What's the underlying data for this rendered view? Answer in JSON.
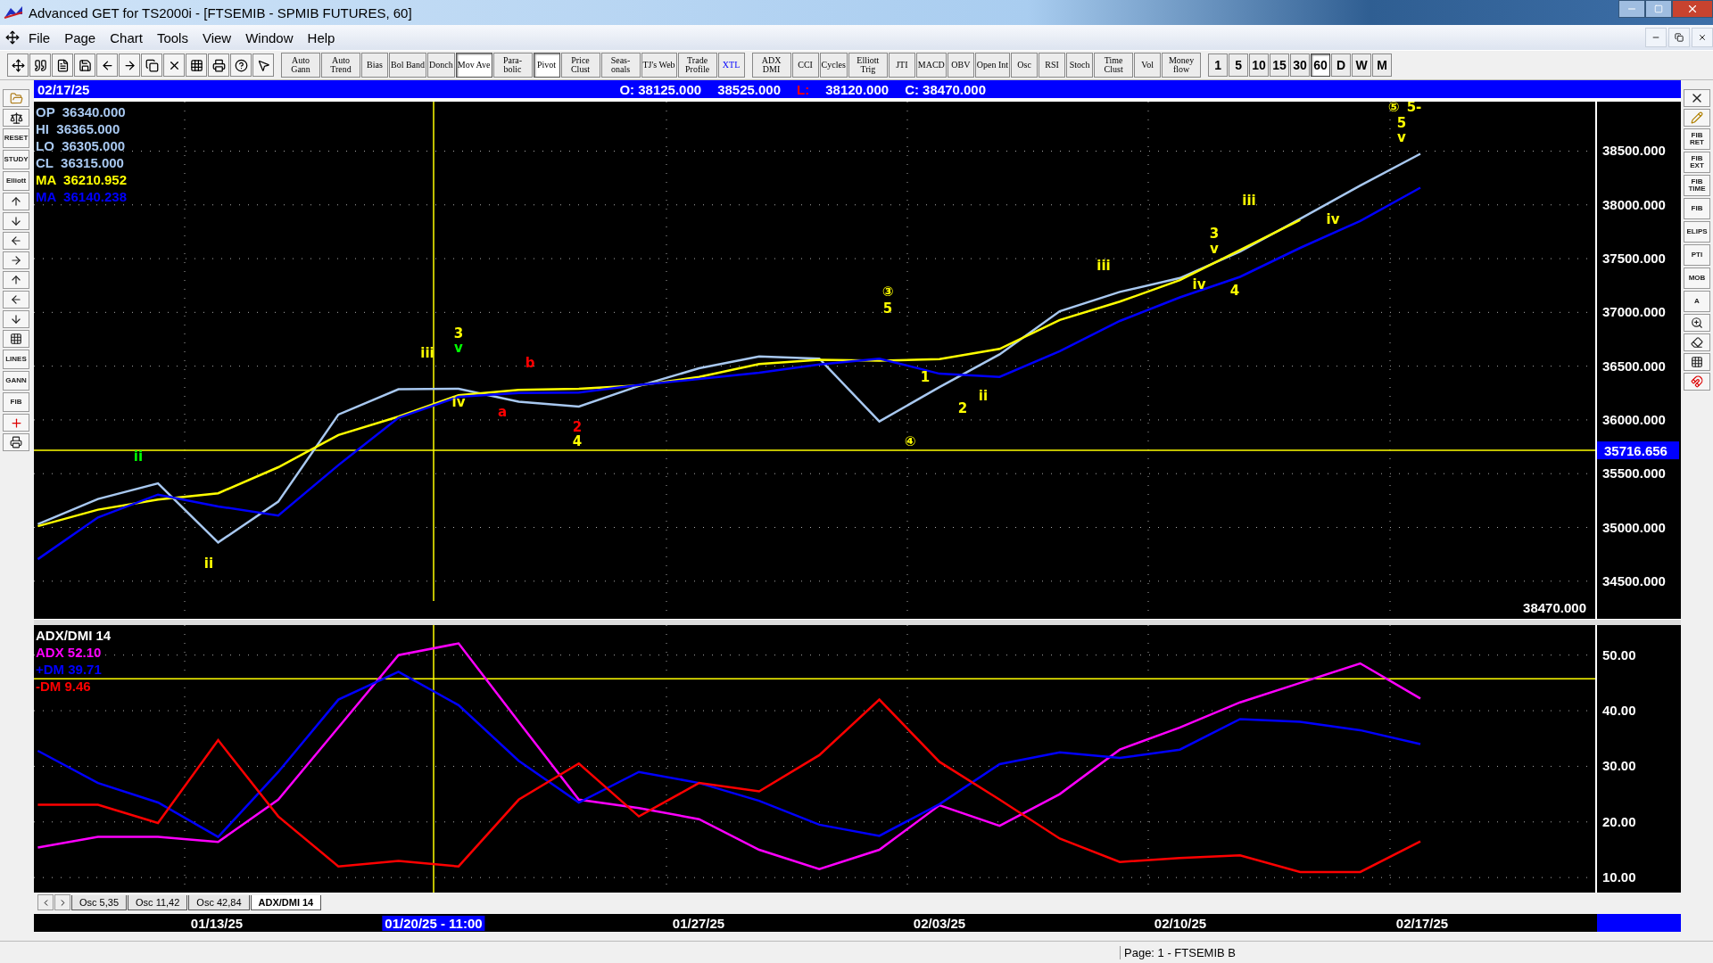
{
  "window": {
    "title": "Advanced GET for TS2000i - [FTSEMIB - SPMIB FUTURES, 60]"
  },
  "menu": [
    "File",
    "Page",
    "Chart",
    "Tools",
    "View",
    "Window",
    "Help"
  ],
  "toolbar": {
    "study_buttons": [
      {
        "label": "Auto Gann",
        "selected": false
      },
      {
        "label": "Auto Trend",
        "selected": false
      },
      {
        "label": "Bias",
        "selected": false
      },
      {
        "label": "Bol Band",
        "selected": false
      },
      {
        "label": "Donch",
        "selected": false
      },
      {
        "label": "Mov Ave",
        "selected": true
      },
      {
        "label": "Para-bolic",
        "selected": false
      },
      {
        "label": "Pivot",
        "selected": true
      },
      {
        "label": "Price Clust",
        "selected": false
      },
      {
        "label": "Seas-onals",
        "selected": false
      },
      {
        "label": "TJ's Web",
        "selected": false
      },
      {
        "label": "Trade Profile",
        "selected": false
      },
      {
        "label": "XTL",
        "selected": false
      }
    ],
    "indicator_buttons": [
      {
        "label": "ADX DMI",
        "selected": false
      },
      {
        "label": "CCI",
        "selected": false
      },
      {
        "label": "Cycles",
        "selected": false
      },
      {
        "label": "Elliott Trig",
        "selected": false
      },
      {
        "label": "JTI",
        "selected": false
      },
      {
        "label": "MACD",
        "selected": false
      },
      {
        "label": "OBV",
        "selected": false
      },
      {
        "label": "Open Int",
        "selected": false
      },
      {
        "label": "Osc",
        "selected": false
      },
      {
        "label": "RSI",
        "selected": false
      },
      {
        "label": "Stoch",
        "selected": false
      },
      {
        "label": "Time Clust",
        "selected": false
      },
      {
        "label": "Vol",
        "selected": false
      },
      {
        "label": "Money flow",
        "selected": false
      }
    ],
    "interval_buttons": [
      {
        "label": "1",
        "selected": false
      },
      {
        "label": "5",
        "selected": false
      },
      {
        "label": "10",
        "selected": false
      },
      {
        "label": "15",
        "selected": false
      },
      {
        "label": "30",
        "selected": false
      },
      {
        "label": "60",
        "selected": true
      },
      {
        "label": "D",
        "selected": false
      },
      {
        "label": "W",
        "selected": false
      },
      {
        "label": "M",
        "selected": false
      }
    ]
  },
  "left_tools_top": [
    "RESET",
    "STUDY",
    "Elliott"
  ],
  "left_tools_bottom": [
    "LINES",
    "GANN",
    "FIB"
  ],
  "right_tools": [
    "FIB RET",
    "FIB EXT",
    "FIB TIME",
    "FIB",
    "ELIPS",
    "PTI",
    "MOB",
    "A"
  ],
  "header": {
    "date": "02/17/25",
    "fields": [
      {
        "text": "O: 38125.000",
        "kind": "plain"
      },
      {
        "text": "38525.000",
        "kind": "plain"
      },
      {
        "text": "L:",
        "kind": "alert"
      },
      {
        "text": "38120.000",
        "kind": "plain"
      },
      {
        "text": "C: 38470.000",
        "kind": "plain"
      }
    ]
  },
  "price_pane": {
    "legend": [
      {
        "label": "OP",
        "value": "36340.000"
      },
      {
        "label": "HI",
        "value": "36365.000"
      },
      {
        "label": "LO",
        "value": "36305.000"
      }
    ],
    "series_readouts": [
      "36315.000",
      "36210.952",
      "36140.238"
    ],
    "last_price": "38470.000",
    "wave_labels": [
      {
        "text": "ii",
        "color": "#00ff00"
      },
      {
        "text": "ii",
        "color": "#ffff00"
      },
      {
        "text": "iii",
        "color": "#ffff00"
      },
      {
        "text": "3",
        "color": "#ffff00"
      },
      {
        "text": "v",
        "color": "#00ff00"
      },
      {
        "text": "iv",
        "color": "#ffff00"
      },
      {
        "text": "b",
        "color": "#ff0000"
      },
      {
        "text": "a",
        "color": "#ff0000"
      },
      {
        "text": "2",
        "color": "#ff0000"
      },
      {
        "text": "4",
        "color": "#ffff00"
      },
      {
        "text": "③",
        "color": "#ffff00"
      },
      {
        "text": "5",
        "color": "#ffff00"
      },
      {
        "text": "④",
        "color": "#ffff00"
      },
      {
        "text": "1",
        "color": "#ffff00"
      },
      {
        "text": "2",
        "color": "#ffff00"
      },
      {
        "text": "ii",
        "color": "#ffff00"
      },
      {
        "text": "iii",
        "color": "#ffff00"
      },
      {
        "text": "3",
        "color": "#ffff00"
      },
      {
        "text": "v",
        "color": "#ffff00"
      },
      {
        "text": "iv",
        "color": "#ffff00"
      },
      {
        "text": "4",
        "color": "#ffff00"
      },
      {
        "text": "iii",
        "color": "#ffff00"
      },
      {
        "text": "iv",
        "color": "#ffff00"
      },
      {
        "text": "⑤",
        "color": "#ffff00"
      },
      {
        "text": "5-",
        "color": "#ffff00"
      },
      {
        "text": "5",
        "color": "#ffff00"
      },
      {
        "text": "v",
        "color": "#ffff00"
      }
    ],
    "chart_data": {
      "type": "line",
      "grid": true,
      "categories": [
        null,
        null,
        null,
        null,
        null,
        null,
        null,
        null,
        null,
        null,
        null,
        null,
        null,
        null,
        null,
        null,
        null,
        null,
        null,
        null,
        null,
        null,
        null,
        null
      ],
      "series": [
        {
          "name": "CL",
          "color": "#a8c8f0",
          "values": [
            35030,
            35265,
            35410,
            34860,
            35240,
            36050,
            36285,
            36290,
            36170,
            36125,
            36315,
            36480,
            36590,
            36570,
            35985,
            36305,
            36610,
            37010,
            37190,
            37320,
            37565,
            37870,
            38180,
            38475
          ]
        },
        {
          "name": "MA",
          "color": "#ffff00",
          "values": [
            35012,
            35165,
            35260,
            35318,
            35560,
            35860,
            36030,
            36230,
            36280,
            36290,
            36320,
            36400,
            36520,
            36560,
            36550,
            36566,
            36660,
            36930,
            37100,
            37300,
            37580,
            37860,
            null,
            null
          ]
        },
        {
          "name": "MA",
          "color": "#0000ff",
          "values": [
            34705,
            35093,
            35305,
            35196,
            35110,
            35580,
            36020,
            36215,
            36250,
            36255,
            36325,
            36380,
            36440,
            36515,
            36570,
            36430,
            36400,
            36640,
            36920,
            37140,
            37330,
            37600,
            37850,
            38160
          ]
        }
      ],
      "ylim": [
        34150,
        38960
      ],
      "yticks": [
        {
          "value": 34500,
          "label": "34500.000"
        },
        {
          "value": 35000,
          "label": "35000.000"
        },
        {
          "value": 35500,
          "label": "35500.000"
        },
        {
          "value": 36000,
          "label": "36000.000"
        },
        {
          "value": 36500,
          "label": "36500.000"
        },
        {
          "value": 37000,
          "label": "37000.000"
        },
        {
          "value": 37500,
          "label": "37500.000"
        },
        {
          "value": 38000,
          "label": "38000.000"
        },
        {
          "value": 38500,
          "label": "38500.000"
        }
      ],
      "ref_lines": [
        {
          "axis": "y",
          "value": 35716.656,
          "label": "35716.656"
        }
      ]
    }
  },
  "indicator_pane": {
    "series_readouts": [
      "52.10",
      "39.71",
      "9.46"
    ],
    "chart_data": {
      "type": "line",
      "grid": true,
      "title": "ADX/DMI 14",
      "categories": [
        null,
        null,
        null,
        null,
        null,
        null,
        null,
        null,
        null,
        null,
        null,
        null,
        null,
        null,
        null,
        null,
        null,
        null,
        null,
        null,
        null,
        null,
        null,
        null
      ],
      "series": [
        {
          "name": "ADX",
          "color": "#ff00ff",
          "values": [
            15.4,
            17.3,
            17.3,
            16.4,
            24,
            37,
            50,
            52.1,
            38,
            24,
            22.5,
            20.5,
            15,
            11.5,
            15,
            23,
            19.3,
            25,
            33,
            37,
            41.5,
            45,
            48.5,
            42.2
          ]
        },
        {
          "name": "+DM",
          "color": "#0000ff",
          "values": [
            32.8,
            27,
            23.5,
            17.3,
            29,
            42,
            47,
            41,
            31,
            23.5,
            29,
            27,
            23.8,
            19.5,
            17.5,
            23.2,
            30.4,
            32.5,
            31.5,
            33,
            38.5,
            38,
            36.5,
            34
          ]
        },
        {
          "name": "-DM",
          "color": "#ff0000",
          "values": [
            23.1,
            23.1,
            19.8,
            34.7,
            21,
            12,
            13,
            12,
            24,
            30.5,
            21,
            27,
            25.5,
            32,
            42,
            30.8,
            24,
            17,
            12.8,
            13.5,
            14,
            11,
            11,
            16.5
          ]
        }
      ],
      "ylim": [
        7.3,
        55.4
      ],
      "yticks": [
        {
          "value": 10,
          "label": "10.00"
        },
        {
          "value": 20,
          "label": "20.00"
        },
        {
          "value": 30,
          "label": "30.00"
        },
        {
          "value": 40,
          "label": "40.00"
        },
        {
          "value": 50,
          "label": "50.00"
        }
      ],
      "ref_lines": [
        {
          "axis": "y",
          "value": 45.75
        }
      ]
    }
  },
  "tabs": [
    {
      "label": "Osc 5,35",
      "selected": false
    },
    {
      "label": "Osc 11,42",
      "selected": false
    },
    {
      "label": "Osc 42,84",
      "selected": false
    },
    {
      "label": "ADX/DMI 14",
      "selected": true
    }
  ],
  "date_axis": [
    {
      "label": "01/13/25",
      "selected": false
    },
    {
      "label": "01/20/25 - 11:00",
      "selected": true
    },
    {
      "label": "01/27/25",
      "selected": false
    },
    {
      "label": "02/03/25",
      "selected": false
    },
    {
      "label": "02/10/25",
      "selected": false
    },
    {
      "label": "02/17/25",
      "selected": false
    }
  ],
  "status_bar": "Page: 1 - FTSEMIB B"
}
